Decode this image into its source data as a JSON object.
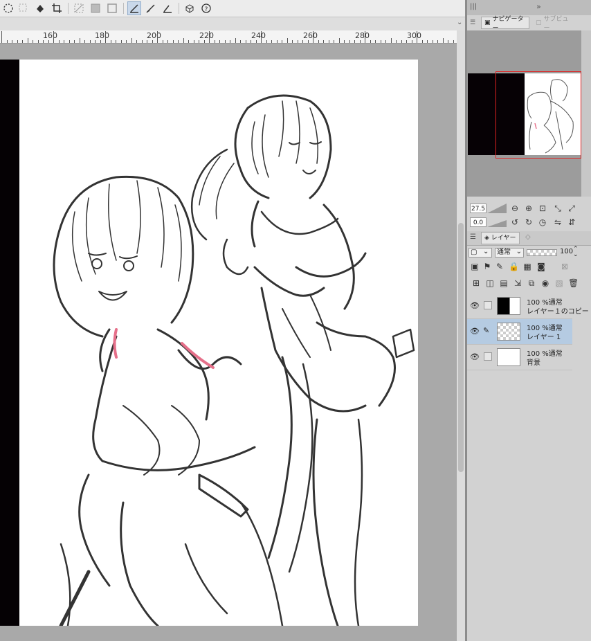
{
  "ruler": {
    "labels": [
      "160",
      "180",
      "200",
      "220",
      "240",
      "260",
      "280",
      "300"
    ]
  },
  "toolbar": {
    "icons": [
      "selection-icon",
      "deselect-icon",
      "fill-icon",
      "crop-icon",
      "clear-icon",
      "fill-selection-icon",
      "border-icon",
      "ruler-snap-icon",
      "brush-snap-icon",
      "perspective-icon",
      "3d-icon",
      "help-icon"
    ]
  },
  "panel": {
    "tabs": {
      "navigator": "ナビゲーター",
      "subview": "サブビュー"
    },
    "zoom": "27.5",
    "rotation": "0.0",
    "layer_tab": "レイヤー",
    "blend_mode": "通常",
    "opacity": "100"
  },
  "layers": [
    {
      "line1": "100 %通常",
      "line2": "レイヤー１のコピー",
      "thumb": "black",
      "selected": false
    },
    {
      "line1": "100 %通常",
      "line2": "レイヤー 1",
      "thumb": "sketch",
      "selected": true
    },
    {
      "line1": "100 %通常",
      "line2": "背景",
      "thumb": "white",
      "selected": false
    }
  ],
  "colors": {
    "accent": "#b5cbe2",
    "selection_frame": "#e02020",
    "canvas_bg": "#a9a9a9"
  }
}
